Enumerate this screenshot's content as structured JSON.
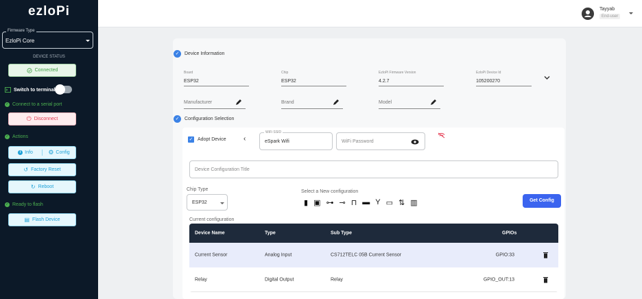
{
  "sidebar": {
    "logo": "ezloPi",
    "firmware_type": {
      "label": "Firmware Type",
      "value": "EzloPi Core"
    },
    "device_status_title": "DEVICE STATUS",
    "connected_label": "Connected",
    "switch_terminal_label": "Switch to terminal",
    "serial_port_label": "Connect to a serial port",
    "disconnect_label": "Disconnect",
    "actions_label": "Actions",
    "info_label": "Info",
    "config_label": "Config",
    "factory_reset_label": "Factory Reset",
    "reboot_label": "Reboot",
    "ready_label": "Ready to flash",
    "flash_label": "Flash Device"
  },
  "topbar": {
    "user_name": "Tayyab",
    "user_role": "End-user"
  },
  "device_info": {
    "title": "Device Information",
    "board": {
      "label": "Board",
      "value": "ESP32"
    },
    "chip": {
      "label": "Chip",
      "value": "ESP32"
    },
    "firmware_version": {
      "label": "EzloPi Firmware Version",
      "value": "4.2.7"
    },
    "device_id": {
      "label": "EzloPi Device Id",
      "value": "105200270"
    },
    "manufacturer_placeholder": "Manufacturer",
    "brand_placeholder": "Brand",
    "model_placeholder": "Model"
  },
  "config": {
    "title": "Configuration Selection",
    "adopt_label": "Adopt Device",
    "wifi_ssid_label": "WiFi SSID",
    "wifi_ssid_value": "eSpark Wifi",
    "wifi_password_placeholder": "WiFi Password",
    "title_placeholder": "Device Configuration Title",
    "chip_type_label": "Chip Type",
    "chip_type_value": "ESP32",
    "new_config_label": "Select a New configuration",
    "get_config_label": "Get Config",
    "current_config_label": "Current configuration"
  },
  "table": {
    "headers": [
      "Device Name",
      "Type",
      "Sub Type",
      "GPIOs"
    ],
    "rows": [
      [
        "Current Sensor",
        "Analog Input",
        "CS712TELC 05B Current Sensor",
        "GPIO:33"
      ],
      [
        "Relay",
        "Digital Output",
        "Relay",
        "GPIO_OUT:13"
      ]
    ]
  },
  "colors": {
    "sidebar_bg": "#0c1928",
    "accent": "#3b64ef",
    "table_header": "#1e2a3b",
    "highlight_row": "#e8ecfb"
  }
}
